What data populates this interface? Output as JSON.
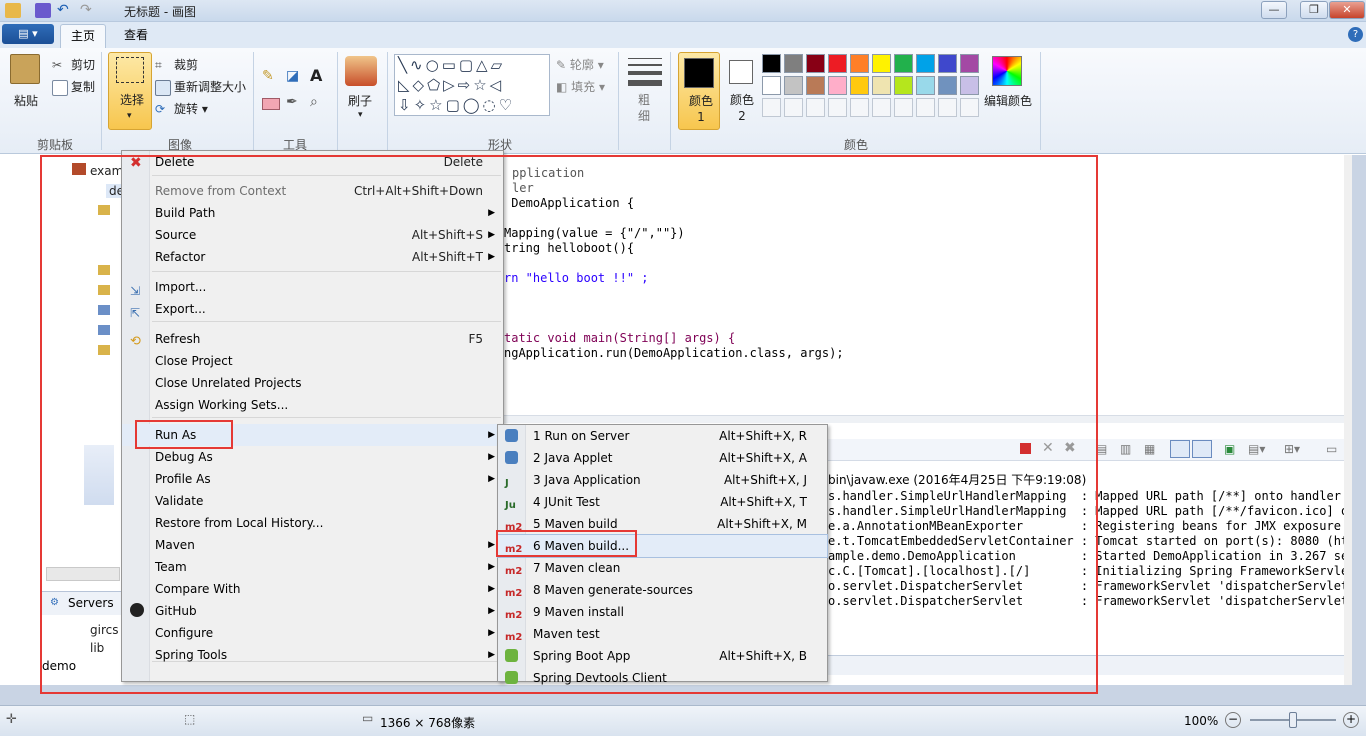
{
  "window": {
    "title": "无标题 - 画图"
  },
  "ribbon": {
    "file_menu_label": "",
    "tabs": [
      "主页",
      "查看"
    ],
    "clipboard": {
      "paste": "粘贴",
      "cut": "剪切",
      "copy": "复制",
      "group": "剪贴板"
    },
    "image": {
      "select": "选择",
      "crop": "裁剪",
      "resize": "重新调整大小",
      "rotate": "旋转",
      "group": "图像"
    },
    "tools": {
      "group": "工具"
    },
    "brushes": {
      "label": "刷子"
    },
    "shapes": {
      "outline": "轮廓",
      "fill": "填充",
      "group": "形状"
    },
    "size": {
      "label": "粗细"
    },
    "colors": {
      "color1": "颜色 1",
      "color2": "颜色 2",
      "edit": "编辑颜色",
      "group": "颜色"
    }
  },
  "palette": [
    "#000000",
    "#7f7f7f",
    "#880015",
    "#ed1c24",
    "#ff7f27",
    "#fff200",
    "#22b14c",
    "#00a2e8",
    "#3f48cc",
    "#a349a4",
    "#ffffff",
    "#c3c3c3",
    "#b97a57",
    "#ffaec9",
    "#ffc90e",
    "#efe4b0",
    "#b5e61d",
    "#99d9ea",
    "#7092be",
    "#c8bfe7"
  ],
  "screenshot": {
    "tree_items": [
      "exam",
      "de"
    ],
    "servers_tab": "Servers",
    "servers_items": [
      "gircs",
      "lib"
    ],
    "project_label": "demo",
    "code_lines": [
      "pplication",
      "ler",
      " DemoApplication {",
      "Mapping(value = {\"/\",\"\"})",
      "tring helloboot(){",
      "rn \"hello boot !!\" ;",
      "tatic void main(String[] args) {",
      "ngApplication.run(DemoApplication.class, args);"
    ],
    "console_header": "bin\\javaw.exe (2016年4月25日 下午9:19:08)",
    "console_lines": [
      "s.handler.SimpleUrlHandlerMapping  : Mapped URL path [/**] onto handler of",
      "s.handler.SimpleUrlHandlerMapping  : Mapped URL path [/**/favicon.ico] ontc",
      "e.a.AnnotationMBeanExporter        : Registering beans for JMX exposure on",
      "e.t.TomcatEmbeddedServletContainer : Tomcat started on port(s): 8080 (http)",
      "ample.demo.DemoApplication         : Started DemoApplication in 3.267 secor",
      "c.C.[Tomcat].[localhost].[/]       : Initializing Spring FrameworkServlet '",
      "o.servlet.DispatcherServlet        : FrameworkServlet 'dispatcherServlet':",
      "o.servlet.DispatcherServlet        : FrameworkServlet 'dispatcherServlet':"
    ],
    "context_menu": [
      {
        "label": "Delete",
        "shortcut": "Delete",
        "arrow": ""
      },
      {
        "label": "Remove from Context",
        "shortcut": "Ctrl+Alt+Shift+Down",
        "arrow": ""
      },
      {
        "label": "Build Path",
        "shortcut": "",
        "arrow": "▶"
      },
      {
        "label": "Source",
        "shortcut": "Alt+Shift+S",
        "arrow": "▶"
      },
      {
        "label": "Refactor",
        "shortcut": "Alt+Shift+T",
        "arrow": "▶"
      },
      {
        "label": "Import...",
        "shortcut": "",
        "arrow": ""
      },
      {
        "label": "Export...",
        "shortcut": "",
        "arrow": ""
      },
      {
        "label": "Refresh",
        "shortcut": "F5",
        "arrow": ""
      },
      {
        "label": "Close Project",
        "shortcut": "",
        "arrow": ""
      },
      {
        "label": "Close Unrelated Projects",
        "shortcut": "",
        "arrow": ""
      },
      {
        "label": "Assign Working Sets...",
        "shortcut": "",
        "arrow": ""
      },
      {
        "label": "Run As",
        "shortcut": "",
        "arrow": "▶"
      },
      {
        "label": "Debug As",
        "shortcut": "",
        "arrow": "▶"
      },
      {
        "label": "Profile As",
        "shortcut": "",
        "arrow": "▶"
      },
      {
        "label": "Validate",
        "shortcut": "",
        "arrow": ""
      },
      {
        "label": "Restore from Local History...",
        "shortcut": "",
        "arrow": ""
      },
      {
        "label": "Maven",
        "shortcut": "",
        "arrow": "▶"
      },
      {
        "label": "Team",
        "shortcut": "",
        "arrow": "▶"
      },
      {
        "label": "Compare With",
        "shortcut": "",
        "arrow": "▶"
      },
      {
        "label": "GitHub",
        "shortcut": "",
        "arrow": "▶"
      },
      {
        "label": "Configure",
        "shortcut": "",
        "arrow": "▶"
      },
      {
        "label": "Spring Tools",
        "shortcut": "",
        "arrow": "▶"
      }
    ],
    "run_as_menu": [
      {
        "label": "1 Run on Server",
        "shortcut": "Alt+Shift+X, R",
        "icon": ""
      },
      {
        "label": "2 Java Applet",
        "shortcut": "Alt+Shift+X, A",
        "icon": ""
      },
      {
        "label": "3 Java Application",
        "shortcut": "Alt+Shift+X, J",
        "icon": "J"
      },
      {
        "label": "4 JUnit Test",
        "shortcut": "Alt+Shift+X, T",
        "icon": "Ju"
      },
      {
        "label": "5 Maven build",
        "shortcut": "Alt+Shift+X, M",
        "icon": "m2"
      },
      {
        "label": "6 Maven build...",
        "shortcut": "",
        "icon": "m2"
      },
      {
        "label": "7 Maven clean",
        "shortcut": "",
        "icon": "m2"
      },
      {
        "label": "8 Maven generate-sources",
        "shortcut": "",
        "icon": "m2"
      },
      {
        "label": "9 Maven install",
        "shortcut": "",
        "icon": "m2"
      },
      {
        "label": "Maven test",
        "shortcut": "",
        "icon": "m2"
      },
      {
        "label": "Spring Boot App",
        "shortcut": "Alt+Shift+X, B",
        "icon": ""
      },
      {
        "label": "Spring Devtools Client",
        "shortcut": "",
        "icon": ""
      }
    ]
  },
  "status": {
    "dimensions": "1366 × 768像素",
    "zoom": "100%"
  }
}
